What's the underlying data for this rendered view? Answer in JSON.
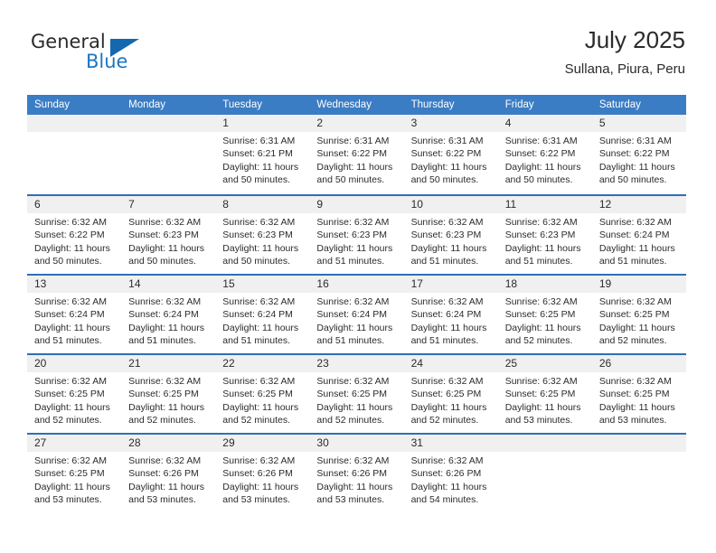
{
  "brand": {
    "name_part1": "General",
    "name_part2": "Blue",
    "triangle_color": "#1368ae",
    "blue_color": "#1b76c4"
  },
  "header": {
    "title": "July 2025",
    "subtitle": "Sullana, Piura, Peru"
  },
  "theme": {
    "header_bg": "#3b7dc4",
    "row_divider": "#2f6fb5",
    "date_band_bg": "#f0f0f0",
    "text": "#2b2b2b"
  },
  "weekdays": [
    "Sunday",
    "Monday",
    "Tuesday",
    "Wednesday",
    "Thursday",
    "Friday",
    "Saturday"
  ],
  "labels": {
    "sunrise_prefix": "Sunrise:",
    "sunset_prefix": "Sunset:",
    "daylight_prefix": "Daylight:"
  },
  "weeks": [
    [
      {
        "day": "",
        "line1": "",
        "line2": "",
        "line3": "",
        "line4": ""
      },
      {
        "day": "",
        "line1": "",
        "line2": "",
        "line3": "",
        "line4": ""
      },
      {
        "day": "1",
        "line1": "Sunrise: 6:31 AM",
        "line2": "Sunset: 6:21 PM",
        "line3": "Daylight: 11 hours",
        "line4": "and 50 minutes."
      },
      {
        "day": "2",
        "line1": "Sunrise: 6:31 AM",
        "line2": "Sunset: 6:22 PM",
        "line3": "Daylight: 11 hours",
        "line4": "and 50 minutes."
      },
      {
        "day": "3",
        "line1": "Sunrise: 6:31 AM",
        "line2": "Sunset: 6:22 PM",
        "line3": "Daylight: 11 hours",
        "line4": "and 50 minutes."
      },
      {
        "day": "4",
        "line1": "Sunrise: 6:31 AM",
        "line2": "Sunset: 6:22 PM",
        "line3": "Daylight: 11 hours",
        "line4": "and 50 minutes."
      },
      {
        "day": "5",
        "line1": "Sunrise: 6:31 AM",
        "line2": "Sunset: 6:22 PM",
        "line3": "Daylight: 11 hours",
        "line4": "and 50 minutes."
      }
    ],
    [
      {
        "day": "6",
        "line1": "Sunrise: 6:32 AM",
        "line2": "Sunset: 6:22 PM",
        "line3": "Daylight: 11 hours",
        "line4": "and 50 minutes."
      },
      {
        "day": "7",
        "line1": "Sunrise: 6:32 AM",
        "line2": "Sunset: 6:23 PM",
        "line3": "Daylight: 11 hours",
        "line4": "and 50 minutes."
      },
      {
        "day": "8",
        "line1": "Sunrise: 6:32 AM",
        "line2": "Sunset: 6:23 PM",
        "line3": "Daylight: 11 hours",
        "line4": "and 50 minutes."
      },
      {
        "day": "9",
        "line1": "Sunrise: 6:32 AM",
        "line2": "Sunset: 6:23 PM",
        "line3": "Daylight: 11 hours",
        "line4": "and 51 minutes."
      },
      {
        "day": "10",
        "line1": "Sunrise: 6:32 AM",
        "line2": "Sunset: 6:23 PM",
        "line3": "Daylight: 11 hours",
        "line4": "and 51 minutes."
      },
      {
        "day": "11",
        "line1": "Sunrise: 6:32 AM",
        "line2": "Sunset: 6:23 PM",
        "line3": "Daylight: 11 hours",
        "line4": "and 51 minutes."
      },
      {
        "day": "12",
        "line1": "Sunrise: 6:32 AM",
        "line2": "Sunset: 6:24 PM",
        "line3": "Daylight: 11 hours",
        "line4": "and 51 minutes."
      }
    ],
    [
      {
        "day": "13",
        "line1": "Sunrise: 6:32 AM",
        "line2": "Sunset: 6:24 PM",
        "line3": "Daylight: 11 hours",
        "line4": "and 51 minutes."
      },
      {
        "day": "14",
        "line1": "Sunrise: 6:32 AM",
        "line2": "Sunset: 6:24 PM",
        "line3": "Daylight: 11 hours",
        "line4": "and 51 minutes."
      },
      {
        "day": "15",
        "line1": "Sunrise: 6:32 AM",
        "line2": "Sunset: 6:24 PM",
        "line3": "Daylight: 11 hours",
        "line4": "and 51 minutes."
      },
      {
        "day": "16",
        "line1": "Sunrise: 6:32 AM",
        "line2": "Sunset: 6:24 PM",
        "line3": "Daylight: 11 hours",
        "line4": "and 51 minutes."
      },
      {
        "day": "17",
        "line1": "Sunrise: 6:32 AM",
        "line2": "Sunset: 6:24 PM",
        "line3": "Daylight: 11 hours",
        "line4": "and 51 minutes."
      },
      {
        "day": "18",
        "line1": "Sunrise: 6:32 AM",
        "line2": "Sunset: 6:25 PM",
        "line3": "Daylight: 11 hours",
        "line4": "and 52 minutes."
      },
      {
        "day": "19",
        "line1": "Sunrise: 6:32 AM",
        "line2": "Sunset: 6:25 PM",
        "line3": "Daylight: 11 hours",
        "line4": "and 52 minutes."
      }
    ],
    [
      {
        "day": "20",
        "line1": "Sunrise: 6:32 AM",
        "line2": "Sunset: 6:25 PM",
        "line3": "Daylight: 11 hours",
        "line4": "and 52 minutes."
      },
      {
        "day": "21",
        "line1": "Sunrise: 6:32 AM",
        "line2": "Sunset: 6:25 PM",
        "line3": "Daylight: 11 hours",
        "line4": "and 52 minutes."
      },
      {
        "day": "22",
        "line1": "Sunrise: 6:32 AM",
        "line2": "Sunset: 6:25 PM",
        "line3": "Daylight: 11 hours",
        "line4": "and 52 minutes."
      },
      {
        "day": "23",
        "line1": "Sunrise: 6:32 AM",
        "line2": "Sunset: 6:25 PM",
        "line3": "Daylight: 11 hours",
        "line4": "and 52 minutes."
      },
      {
        "day": "24",
        "line1": "Sunrise: 6:32 AM",
        "line2": "Sunset: 6:25 PM",
        "line3": "Daylight: 11 hours",
        "line4": "and 52 minutes."
      },
      {
        "day": "25",
        "line1": "Sunrise: 6:32 AM",
        "line2": "Sunset: 6:25 PM",
        "line3": "Daylight: 11 hours",
        "line4": "and 53 minutes."
      },
      {
        "day": "26",
        "line1": "Sunrise: 6:32 AM",
        "line2": "Sunset: 6:25 PM",
        "line3": "Daylight: 11 hours",
        "line4": "and 53 minutes."
      }
    ],
    [
      {
        "day": "27",
        "line1": "Sunrise: 6:32 AM",
        "line2": "Sunset: 6:25 PM",
        "line3": "Daylight: 11 hours",
        "line4": "and 53 minutes."
      },
      {
        "day": "28",
        "line1": "Sunrise: 6:32 AM",
        "line2": "Sunset: 6:26 PM",
        "line3": "Daylight: 11 hours",
        "line4": "and 53 minutes."
      },
      {
        "day": "29",
        "line1": "Sunrise: 6:32 AM",
        "line2": "Sunset: 6:26 PM",
        "line3": "Daylight: 11 hours",
        "line4": "and 53 minutes."
      },
      {
        "day": "30",
        "line1": "Sunrise: 6:32 AM",
        "line2": "Sunset: 6:26 PM",
        "line3": "Daylight: 11 hours",
        "line4": "and 53 minutes."
      },
      {
        "day": "31",
        "line1": "Sunrise: 6:32 AM",
        "line2": "Sunset: 6:26 PM",
        "line3": "Daylight: 11 hours",
        "line4": "and 54 minutes."
      },
      {
        "day": "",
        "line1": "",
        "line2": "",
        "line3": "",
        "line4": ""
      },
      {
        "day": "",
        "line1": "",
        "line2": "",
        "line3": "",
        "line4": ""
      }
    ]
  ]
}
